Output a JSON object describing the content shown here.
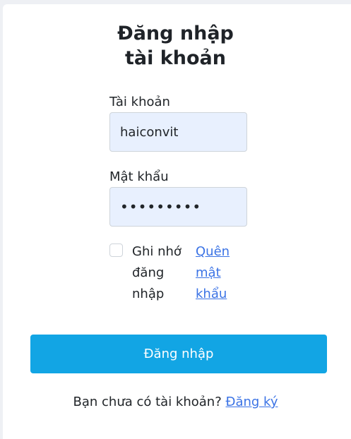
{
  "title": {
    "line1": "Đăng nhập",
    "line2": "tài khoản"
  },
  "username": {
    "label": "Tài khoản",
    "value": "haiconvit"
  },
  "password": {
    "label": "Mật khẩu",
    "value": "•••••••••"
  },
  "remember": {
    "line1": "Ghi nhớ",
    "line2": "đăng",
    "line3": "nhập",
    "checked": false
  },
  "forgot": {
    "line1": "Quên",
    "line2": "mật",
    "line3": "khẩu"
  },
  "login_button": "Đăng nhập",
  "footer": {
    "text": "Bạn chưa có tài khoản?",
    "link": "Đăng ký"
  },
  "colors": {
    "button": "#12a5e4",
    "link": "#3b73e5",
    "input_bg": "#e8f0fe"
  }
}
